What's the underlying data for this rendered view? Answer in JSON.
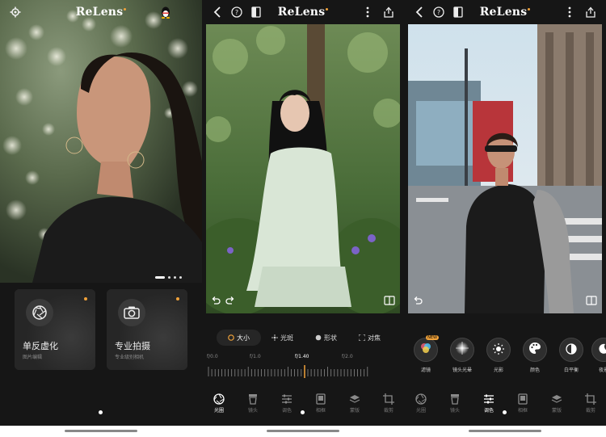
{
  "app": {
    "name": "ReLens"
  },
  "colors": {
    "accent": "#f0a23a",
    "background": "#161616"
  },
  "home": {
    "modes": [
      {
        "title": "单反虚化",
        "subtitle": "图片编辑",
        "icon": "aperture-icon"
      },
      {
        "title": "专业拍摄",
        "subtitle": "专业级别相机",
        "icon": "camera-icon"
      }
    ],
    "carousel": {
      "count": 4,
      "active": 1
    }
  },
  "editor": {
    "aperture_subtabs": [
      "大小",
      "光斑",
      "形状",
      "对焦"
    ],
    "aperture_active": "大小",
    "ruler_labels": [
      "f/0.0",
      "f/1.0",
      "f/1.40",
      "f/2.0"
    ],
    "ruler_current": "f/1.40",
    "tabs": [
      "光圈",
      "镜头",
      "调色",
      "相框",
      "蒙版",
      "裁剪"
    ],
    "active_tab": "光圈"
  },
  "color_editor": {
    "tools": [
      {
        "label": "滤镜",
        "icon": "filter-icon",
        "new": true,
        "new_label": "NEW"
      },
      {
        "label": "镜头光晕",
        "icon": "lens-flare-icon"
      },
      {
        "label": "光影",
        "icon": "light-icon"
      },
      {
        "label": "颜色",
        "icon": "palette-icon"
      },
      {
        "label": "白平衡",
        "icon": "white-balance-icon"
      },
      {
        "label": "夜景",
        "icon": "night-icon"
      }
    ],
    "tabs": [
      "光圈",
      "镜头",
      "调色",
      "相框",
      "蒙版",
      "裁剪"
    ],
    "active_tab": "调色"
  }
}
